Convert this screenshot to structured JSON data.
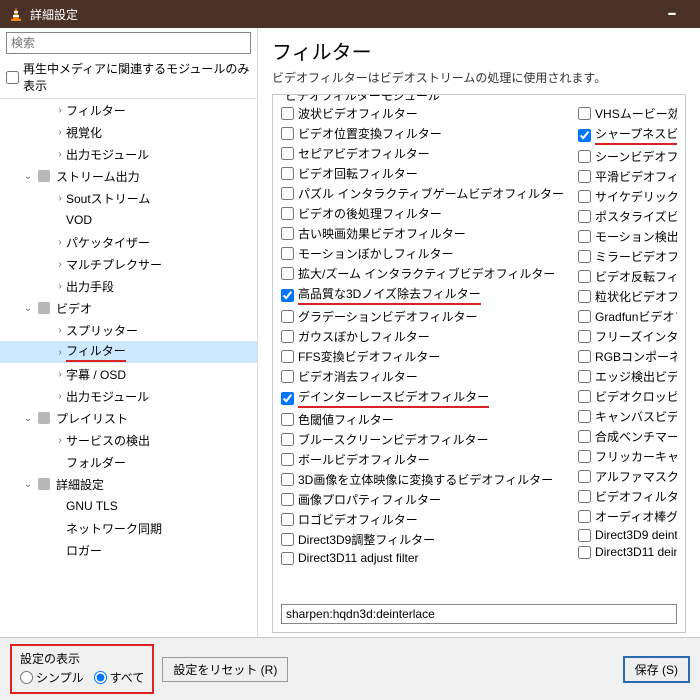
{
  "window": {
    "title": "詳細設定"
  },
  "search": {
    "placeholder": "検索"
  },
  "modOnly": {
    "label": "再生中メディアに関連するモジュールのみ表示"
  },
  "tree": [
    {
      "label": "フィルター",
      "indent": 3,
      "chev": ">"
    },
    {
      "label": "視覚化",
      "indent": 3,
      "chev": ">"
    },
    {
      "label": "出力モジュール",
      "indent": 3,
      "chev": ">"
    },
    {
      "label": "ストリーム出力",
      "indent": 1,
      "chev": "v",
      "icon": true
    },
    {
      "label": "Soutストリーム",
      "indent": 3,
      "chev": ">"
    },
    {
      "label": "VOD",
      "indent": 3,
      "chev": ""
    },
    {
      "label": "パケッタイザー",
      "indent": 3,
      "chev": ">"
    },
    {
      "label": "マルチプレクサー",
      "indent": 3,
      "chev": ">"
    },
    {
      "label": "出力手段",
      "indent": 3,
      "chev": ">"
    },
    {
      "label": "ビデオ",
      "indent": 1,
      "chev": "v",
      "icon": true
    },
    {
      "label": "スプリッター",
      "indent": 3,
      "chev": ">"
    },
    {
      "label": "フィルター",
      "indent": 3,
      "chev": ">",
      "selected": true,
      "underline": true
    },
    {
      "label": "字幕 / OSD",
      "indent": 3,
      "chev": ">"
    },
    {
      "label": "出力モジュール",
      "indent": 3,
      "chev": ">"
    },
    {
      "label": "プレイリスト",
      "indent": 1,
      "chev": "v",
      "icon": true
    },
    {
      "label": "サービスの検出",
      "indent": 3,
      "chev": ">"
    },
    {
      "label": "フォルダー",
      "indent": 3,
      "chev": ""
    },
    {
      "label": "詳細設定",
      "indent": 1,
      "chev": "v",
      "icon": true
    },
    {
      "label": "GNU TLS",
      "indent": 3,
      "chev": ""
    },
    {
      "label": "ネットワーク同期",
      "indent": 3,
      "chev": ""
    },
    {
      "label": "ロガー",
      "indent": 3,
      "chev": ""
    }
  ],
  "page": {
    "title": "フィルター",
    "desc": "ビデオフィルターはビデオストリームの処理に使用されます。",
    "groupTitle": "ビデオフィルターモジュール"
  },
  "filtersLeft": [
    {
      "label": "波状ビデオフィルター",
      "checked": false
    },
    {
      "label": "ビデオ位置変換フィルター",
      "checked": false
    },
    {
      "label": "セピアビデオフィルター",
      "checked": false
    },
    {
      "label": "ビデオ回転フィルター",
      "checked": false
    },
    {
      "label": "パズル インタラクティブゲームビデオフィルター",
      "checked": false
    },
    {
      "label": "ビデオの後処理フィルター",
      "checked": false
    },
    {
      "label": "古い映画効果ビデオフィルター",
      "checked": false
    },
    {
      "label": "モーションぼかしフィルター",
      "checked": false
    },
    {
      "label": "拡大/ズーム インタラクティブビデオフィルター",
      "checked": false
    },
    {
      "label": "高品質な3Dノイズ除去フィルター",
      "checked": true,
      "underline": true
    },
    {
      "label": "グラデーションビデオフィルター",
      "checked": false
    },
    {
      "label": "ガウスぼかしフィルター",
      "checked": false
    },
    {
      "label": "FFS変換ビデオフィルター",
      "checked": false
    },
    {
      "label": "ビデオ消去フィルター",
      "checked": false
    },
    {
      "label": "デインターレースビデオフィルター",
      "checked": true,
      "underline": true
    },
    {
      "label": "色閾値フィルター",
      "checked": false
    },
    {
      "label": "ブルースクリーンビデオフィルター",
      "checked": false
    },
    {
      "label": "ボールビデオフィルター",
      "checked": false
    },
    {
      "label": "3D画像を立体映像に変換するビデオフィルター",
      "checked": false
    },
    {
      "label": "画像プロパティフィルター",
      "checked": false
    },
    {
      "label": "ロゴビデオフィルター",
      "checked": false
    },
    {
      "label": "Direct3D9調整フィルター",
      "checked": false
    },
    {
      "label": "Direct3D11 adjust filter",
      "checked": false
    }
  ],
  "filtersRight": [
    {
      "label": "VHSムービー効果ビデオフィルター",
      "checked": false
    },
    {
      "label": "シャープネスビデオフィルター",
      "checked": true,
      "underline": true
    },
    {
      "label": "シーンビデオフィルター",
      "checked": false
    },
    {
      "label": "平滑ビデオフィルター",
      "checked": false
    },
    {
      "label": "サイケデリックビデオフィルター",
      "checked": false
    },
    {
      "label": "ポスタライズビデオフィルター",
      "checked": false
    },
    {
      "label": "モーション検出ビデオフィルター",
      "checked": false
    },
    {
      "label": "ミラービデオフィルター",
      "checked": false
    },
    {
      "label": "ビデオ反転フィルター",
      "checked": false
    },
    {
      "label": "粒状化ビデオフィルター",
      "checked": false
    },
    {
      "label": "Gradfunビデオフィルター",
      "checked": false
    },
    {
      "label": "フリーズインタラクティブビデオフィルタ",
      "checked": false
    },
    {
      "label": "RGBコンポーネント抽出ビデオフィル",
      "checked": false
    },
    {
      "label": "エッジ検出ビデオフィルター",
      "checked": false
    },
    {
      "label": "ビデオクロッピングフィルター",
      "checked": false
    },
    {
      "label": "キャンバスビデオフィルター",
      "checked": false
    },
    {
      "label": "合成ベンチマークフィルター",
      "checked": false
    },
    {
      "label": "フリッカーキャンセルビデオフィルター",
      "checked": false
    },
    {
      "label": "アルファマスクビデオフィルター",
      "checked": false
    },
    {
      "label": "ビデオフィルターモジュールのチェーン",
      "checked": false
    },
    {
      "label": "オーディオ棒グラフビデオサブソース",
      "checked": false
    },
    {
      "label": "Direct3D9 deinterlace filter",
      "checked": false
    },
    {
      "label": "Direct3D11 deinterlace filter",
      "checked": false
    }
  ],
  "filterString": "sharpen:hqdn3d:deinterlace",
  "footer": {
    "showSettings": "設定の表示",
    "simple": "シンプル",
    "all": "すべて",
    "reset": "設定をリセット (R)",
    "save": "保存 (S)"
  }
}
